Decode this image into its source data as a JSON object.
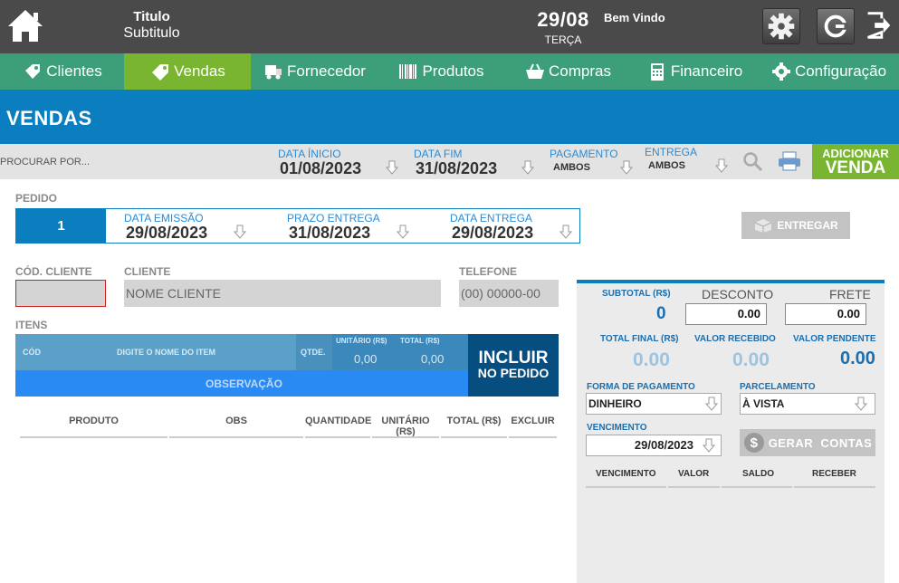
{
  "header": {
    "title": "Titulo",
    "subtitle": "Subtitulo",
    "date": "29/08",
    "weekday": "TERÇA",
    "welcome": "Bem Vindo"
  },
  "nav": {
    "items": [
      {
        "label": "Clientes",
        "icon": "tag-icon"
      },
      {
        "label": "Vendas",
        "icon": "price-tag-icon"
      },
      {
        "label": "Fornecedor",
        "icon": "truck-icon"
      },
      {
        "label": "Produtos",
        "icon": "barcode-icon"
      },
      {
        "label": "Compras",
        "icon": "basket-icon"
      },
      {
        "label": "Financeiro",
        "icon": "calculator-icon"
      },
      {
        "label": "Configuração",
        "icon": "gear-icon"
      }
    ],
    "active": "Vendas"
  },
  "page": {
    "title": "VENDAS"
  },
  "filters": {
    "search_placeholder": "PROCURAR POR...",
    "data_inicio_label": "DATA ÍNICIO",
    "data_inicio": "01/08/2023",
    "data_fim_label": "DATA FIM",
    "data_fim": "31/08/2023",
    "pagamento_label": "PAGAMENTO",
    "pagamento": "AMBOS",
    "entrega_label": "ENTREGA",
    "entrega": "AMBOS",
    "add_line1": "ADICIONAR",
    "add_line2": "VENDA"
  },
  "pedido": {
    "label": "PEDIDO",
    "number": "1",
    "emissao_label": "DATA EMISSÃO",
    "emissao": "29/08/2023",
    "prazo_label": "PRAZO ENTREGA",
    "prazo": "31/08/2023",
    "entrega_label": "DATA ENTREGA",
    "entrega": "29/08/2023",
    "entregar_label": "ENTREGAR"
  },
  "cliente": {
    "cod_label": "CÓD. CLIENTE",
    "cliente_label": "CLIENTE",
    "cliente_placeholder": "NOME CLIENTE",
    "telefone_label": "TELEFONE",
    "telefone_placeholder": "(00) 00000-00"
  },
  "itens": {
    "label": "ITENS",
    "cod": "CÓD",
    "item_placeholder": "DIGITE O NOME  DO ITEM",
    "qtde": "QTDE.",
    "unitario_label": "UNITÁRIO (R$)",
    "total_label": "TOTAL (R$)",
    "unitario": "0,00",
    "total": "0,00",
    "observacao": "OBSERVAÇÃO",
    "incluir_1": "INCLUIR",
    "incluir_2": "NO PEDIDO"
  },
  "table": {
    "columns": [
      "PRODUTO",
      "OBS",
      "QUANTIDADE",
      "UNITÁRIO (R$)",
      "TOTAL (R$)",
      "EXCLUIR"
    ]
  },
  "summary": {
    "subtotal_label": "SUBTOTAL (R$)",
    "subtotal": "0",
    "desconto_label": "DESCONTO",
    "desconto": "0.00",
    "frete_label": "FRETE",
    "frete": "0.00",
    "total_final_label": "TOTAL FINAL (R$)",
    "total_final": "0.00",
    "valor_recebido_label": "VALOR RECEBIDO",
    "valor_recebido": "0.00",
    "valor_pendente_label": "VALOR PENDENTE",
    "valor_pendente": "0.00",
    "forma_label": "FORMA DE PAGAMENTO",
    "forma": "DINHEIRO",
    "parcelamento_label": "PARCELAMENTO",
    "parcelamento": "À VISTA",
    "vencimento_label": "VENCIMENTO",
    "vencimento": "29/08/2023",
    "gerar_label": "GERAR  CONTAS",
    "columns": [
      "VENCIMENTO",
      "VALOR",
      "SALDO",
      "RECEBER"
    ]
  },
  "colors": {
    "topbar": "#4a4a4a",
    "nav": "#3d9f79",
    "nav_active": "#7ab531",
    "primary": "#0b7ec0",
    "accent_green": "#7ab531"
  }
}
